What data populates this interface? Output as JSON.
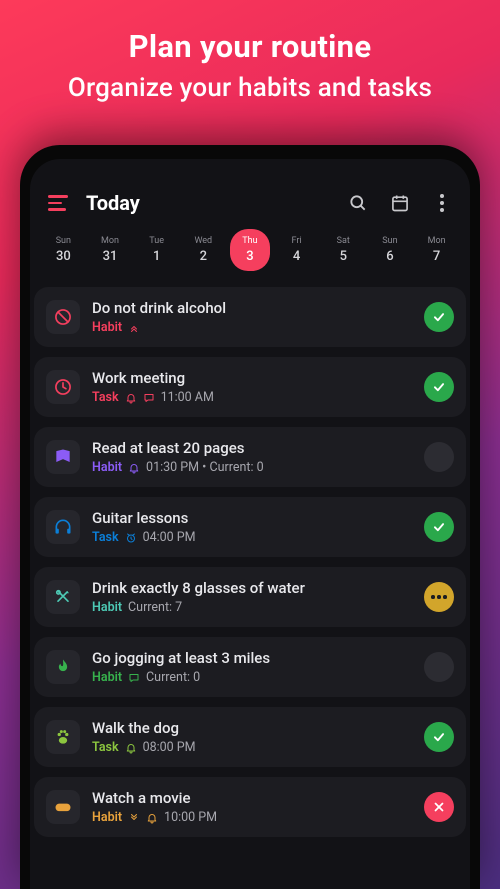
{
  "promo": {
    "title": "Plan your routine",
    "subtitle": "Organize your habits and tasks"
  },
  "header": {
    "title": "Today"
  },
  "days": [
    {
      "dow": "Sun",
      "num": "30",
      "selected": false
    },
    {
      "dow": "Mon",
      "num": "31",
      "selected": false
    },
    {
      "dow": "Tue",
      "num": "1",
      "selected": false
    },
    {
      "dow": "Wed",
      "num": "2",
      "selected": false
    },
    {
      "dow": "Thu",
      "num": "3",
      "selected": true
    },
    {
      "dow": "Fri",
      "num": "4",
      "selected": false
    },
    {
      "dow": "Sat",
      "num": "5",
      "selected": false
    },
    {
      "dow": "Sun",
      "num": "6",
      "selected": false
    },
    {
      "dow": "Mon",
      "num": "7",
      "selected": false
    }
  ],
  "items": [
    {
      "title": "Do not drink alcohol",
      "type": "Habit",
      "type_color": "c-red",
      "icon": "ban",
      "icon_color": "c-red",
      "detail": "",
      "status": "done",
      "sub_icons": [
        "double-chevron-up"
      ]
    },
    {
      "title": "Work meeting",
      "type": "Task",
      "type_color": "c-pink",
      "icon": "clock",
      "icon_color": "c-pink",
      "detail": "11:00 AM",
      "status": "done",
      "sub_icons": [
        "bell",
        "chat"
      ]
    },
    {
      "title": "Read at least 20 pages",
      "type": "Habit",
      "type_color": "c-purple",
      "icon": "book",
      "icon_color": "c-purple",
      "detail": "01:30 PM • Current: 0",
      "status": "none",
      "sub_icons": [
        "bell"
      ]
    },
    {
      "title": "Guitar lessons",
      "type": "Task",
      "type_color": "c-blue",
      "icon": "headphones",
      "icon_color": "c-blue",
      "detail": "04:00 PM",
      "status": "done",
      "sub_icons": [
        "alarm"
      ]
    },
    {
      "title": "Drink exactly 8 glasses of water",
      "type": "Habit",
      "type_color": "c-teal",
      "icon": "utensils",
      "icon_color": "c-teal",
      "detail": "Current: 7",
      "status": "amber",
      "sub_icons": []
    },
    {
      "title": "Go jogging at least 3 miles",
      "type": "Habit",
      "type_color": "c-green",
      "icon": "flame",
      "icon_color": "c-green",
      "detail": "Current: 0",
      "status": "none",
      "sub_icons": [
        "chat"
      ]
    },
    {
      "title": "Walk the dog",
      "type": "Task",
      "type_color": "c-lime",
      "icon": "paw",
      "icon_color": "c-lime",
      "detail": "08:00 PM",
      "status": "done",
      "sub_icons": [
        "bell"
      ]
    },
    {
      "title": "Watch a movie",
      "type": "Habit",
      "type_color": "c-amber",
      "icon": "gamepad",
      "icon_color": "c-amber",
      "detail": "10:00 PM",
      "status": "red",
      "sub_icons": [
        "double-chevron-down",
        "bell"
      ]
    }
  ]
}
